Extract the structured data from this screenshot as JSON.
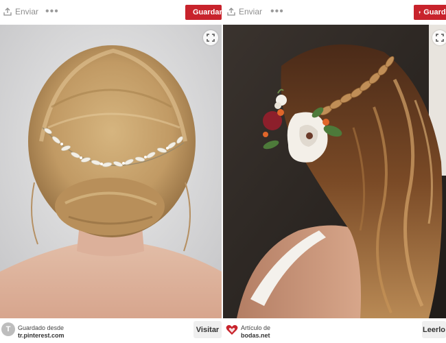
{
  "pins": [
    {
      "send_label": "Enviar",
      "more_label": "•••",
      "save_label": "Guardar",
      "footer_line1": "Guardado desde",
      "footer_line2": "tr.pinterest.com",
      "avatar_letter": "T",
      "action_label": "Visitar",
      "image_subject": "bridal-updo-with-pearl-hair-vine"
    },
    {
      "send_label": "Enviar",
      "more_label": "•••",
      "save_label": "Guardar",
      "footer_line1": "Artículo de",
      "footer_line2": "bodas.net",
      "action_label": "Leerlo",
      "image_subject": "half-up-braid-with-flowers"
    }
  ],
  "colors": {
    "save_red": "#c8232c",
    "muted_text": "#8e8e8e",
    "button_bg": "#efefef"
  },
  "icons": {
    "send": "share-icon",
    "more": "more-icon",
    "save": "pin-icon",
    "expand": "expand-icon",
    "heart": "heart-icon"
  }
}
